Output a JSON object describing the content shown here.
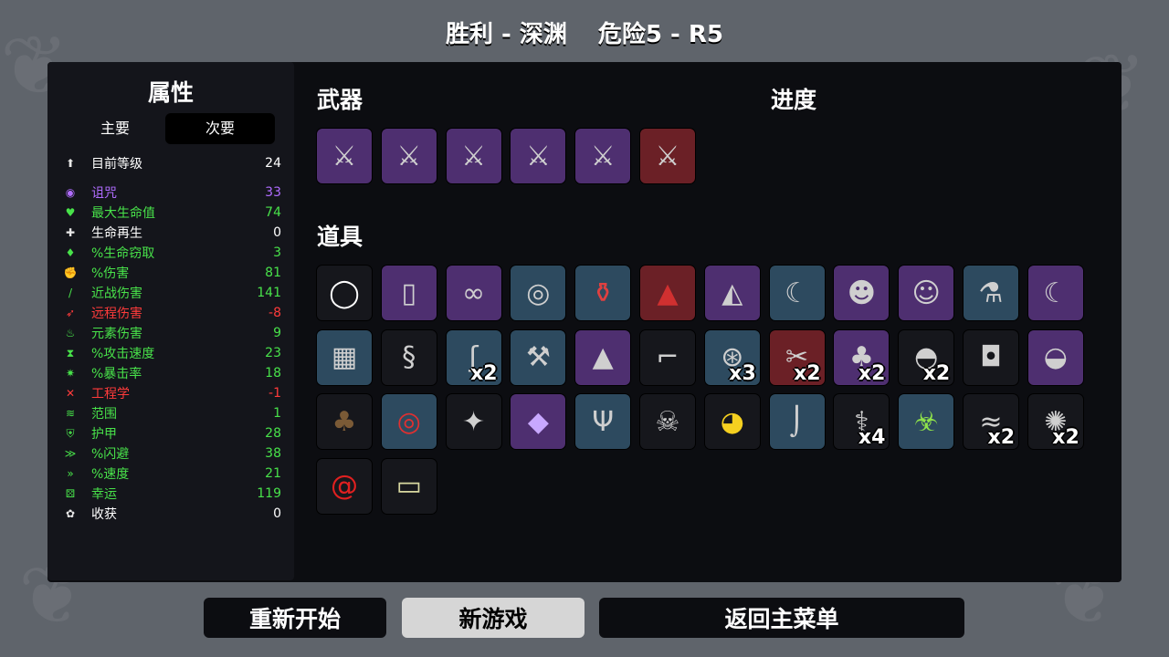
{
  "header": {
    "result": "胜利 - 深渊",
    "danger": "危险5 - R5"
  },
  "stats": {
    "title": "属性",
    "tabs": [
      "主要",
      "次要"
    ],
    "rows": [
      {
        "name": "目前等级",
        "value": "24",
        "color": "#ffffff",
        "icon": "level-up-icon"
      },
      {
        "name": "诅咒",
        "value": "33",
        "color": "#b06cff",
        "icon": "curse-eye-icon"
      },
      {
        "name": "最大生命值",
        "value": "74",
        "color": "#48e24a",
        "icon": "heart-icon"
      },
      {
        "name": "生命再生",
        "value": "0",
        "color": "#ffffff",
        "icon": "regen-heart-icon"
      },
      {
        "name": "%生命窃取",
        "value": "3",
        "color": "#48e24a",
        "icon": "lifesteal-icon"
      },
      {
        "name": "%伤害",
        "value": "81",
        "color": "#48e24a",
        "icon": "damage-muscle-icon"
      },
      {
        "name": "近战伤害",
        "value": "141",
        "color": "#48e24a",
        "icon": "melee-sword-icon"
      },
      {
        "name": "远程伤害",
        "value": "-8",
        "color": "#ff3b3b",
        "icon": "ranged-bow-icon"
      },
      {
        "name": "元素伤害",
        "value": "9",
        "color": "#48e24a",
        "icon": "elemental-flame-icon"
      },
      {
        "name": "%攻击速度",
        "value": "23",
        "color": "#48e24a",
        "icon": "attack-speed-hourglass-icon"
      },
      {
        "name": "%暴击率",
        "value": "18",
        "color": "#48e24a",
        "icon": "crit-chance-icon"
      },
      {
        "name": "工程学",
        "value": "-1",
        "color": "#ff3b3b",
        "icon": "engineering-wrench-icon"
      },
      {
        "name": "范围",
        "value": "1",
        "color": "#48e24a",
        "icon": "range-wave-icon"
      },
      {
        "name": "护甲",
        "value": "28",
        "color": "#48e24a",
        "icon": "armor-shield-icon"
      },
      {
        "name": "%闪避",
        "value": "38",
        "color": "#48e24a",
        "icon": "dodge-icon"
      },
      {
        "name": "%速度",
        "value": "21",
        "color": "#48e24a",
        "icon": "speed-boot-icon"
      },
      {
        "name": "幸运",
        "value": "119",
        "color": "#48e24a",
        "icon": "luck-dice-icon"
      },
      {
        "name": "收获",
        "value": "0",
        "color": "#ffffff",
        "icon": "harvest-wheat-icon"
      }
    ]
  },
  "weapons": {
    "title": "武器",
    "items": [
      {
        "tier": 2,
        "icon": "sword-icon"
      },
      {
        "tier": 2,
        "icon": "sword-icon"
      },
      {
        "tier": 2,
        "icon": "sword-icon"
      },
      {
        "tier": 2,
        "icon": "sword-icon"
      },
      {
        "tier": 2,
        "icon": "sword-icon"
      },
      {
        "tier": 3,
        "icon": "sword-icon"
      }
    ]
  },
  "progress": {
    "title": "进度"
  },
  "items": {
    "title": "道具",
    "list": [
      {
        "tier": 0,
        "icon": "egg-mustache-icon",
        "count": ""
      },
      {
        "tier": 2,
        "icon": "mirror-icon",
        "count": ""
      },
      {
        "tier": 2,
        "icon": "rope-icon",
        "count": ""
      },
      {
        "tier": 1,
        "icon": "spyglass-icon",
        "count": ""
      },
      {
        "tier": 1,
        "icon": "potion-bottle-icon",
        "count": ""
      },
      {
        "tier": 3,
        "icon": "gnome-icon",
        "count": ""
      },
      {
        "tier": 2,
        "icon": "cloth-bag-icon",
        "count": ""
      },
      {
        "tier": 1,
        "icon": "claw-blade-icon",
        "count": ""
      },
      {
        "tier": 2,
        "icon": "lucky-cat-icon",
        "count": ""
      },
      {
        "tier": 2,
        "icon": "alien-head-icon",
        "count": ""
      },
      {
        "tier": 1,
        "icon": "flask-icon",
        "count": ""
      },
      {
        "tier": 2,
        "icon": "claw-blade-icon",
        "count": ""
      },
      {
        "tier": 1,
        "icon": "vest-icon",
        "count": ""
      },
      {
        "tier": 0,
        "icon": "snake-icon",
        "count": ""
      },
      {
        "tier": 1,
        "icon": "larva-icon",
        "count": "x2"
      },
      {
        "tier": 1,
        "icon": "wrench-tool-icon",
        "count": ""
      },
      {
        "tier": 2,
        "icon": "witch-hat-icon",
        "count": ""
      },
      {
        "tier": 0,
        "icon": "scythe-icon",
        "count": ""
      },
      {
        "tier": 1,
        "icon": "helicopter-ball-icon",
        "count": "x3"
      },
      {
        "tier": 3,
        "icon": "dagger-pair-icon",
        "count": "x2"
      },
      {
        "tier": 2,
        "icon": "stump-icon",
        "count": "x2"
      },
      {
        "tier": 0,
        "icon": "helmet-icon",
        "count": "x2"
      },
      {
        "tier": 0,
        "icon": "black-belt-icon",
        "count": ""
      },
      {
        "tier": 2,
        "icon": "knight-helmet-icon",
        "count": ""
      },
      {
        "tier": 0,
        "icon": "tree-icon",
        "count": ""
      },
      {
        "tier": 1,
        "icon": "red-ring-icon",
        "count": ""
      },
      {
        "tier": 0,
        "icon": "meat-skewer-icon",
        "count": ""
      },
      {
        "tier": 2,
        "icon": "crystal-icon",
        "count": ""
      },
      {
        "tier": 1,
        "icon": "antlers-icon",
        "count": ""
      },
      {
        "tier": 0,
        "icon": "goat-skull-icon",
        "count": ""
      },
      {
        "tier": 0,
        "icon": "rubber-duck-icon",
        "count": ""
      },
      {
        "tier": 1,
        "icon": "fish-hook-icon",
        "count": ""
      },
      {
        "tier": 0,
        "icon": "syringe-icon",
        "count": "x4"
      },
      {
        "tier": 1,
        "icon": "toxic-bag-icon",
        "count": ""
      },
      {
        "tier": 0,
        "icon": "lizard-icon",
        "count": "x2"
      },
      {
        "tier": 0,
        "icon": "hedgehog-icon",
        "count": "x2"
      },
      {
        "tier": 0,
        "icon": "red-snail-icon",
        "count": ""
      },
      {
        "tier": 0,
        "icon": "treasure-map-icon",
        "count": ""
      }
    ]
  },
  "buttons": {
    "restart": "重新开始",
    "new_game": "新游戏",
    "main_menu": "返回主菜单"
  }
}
